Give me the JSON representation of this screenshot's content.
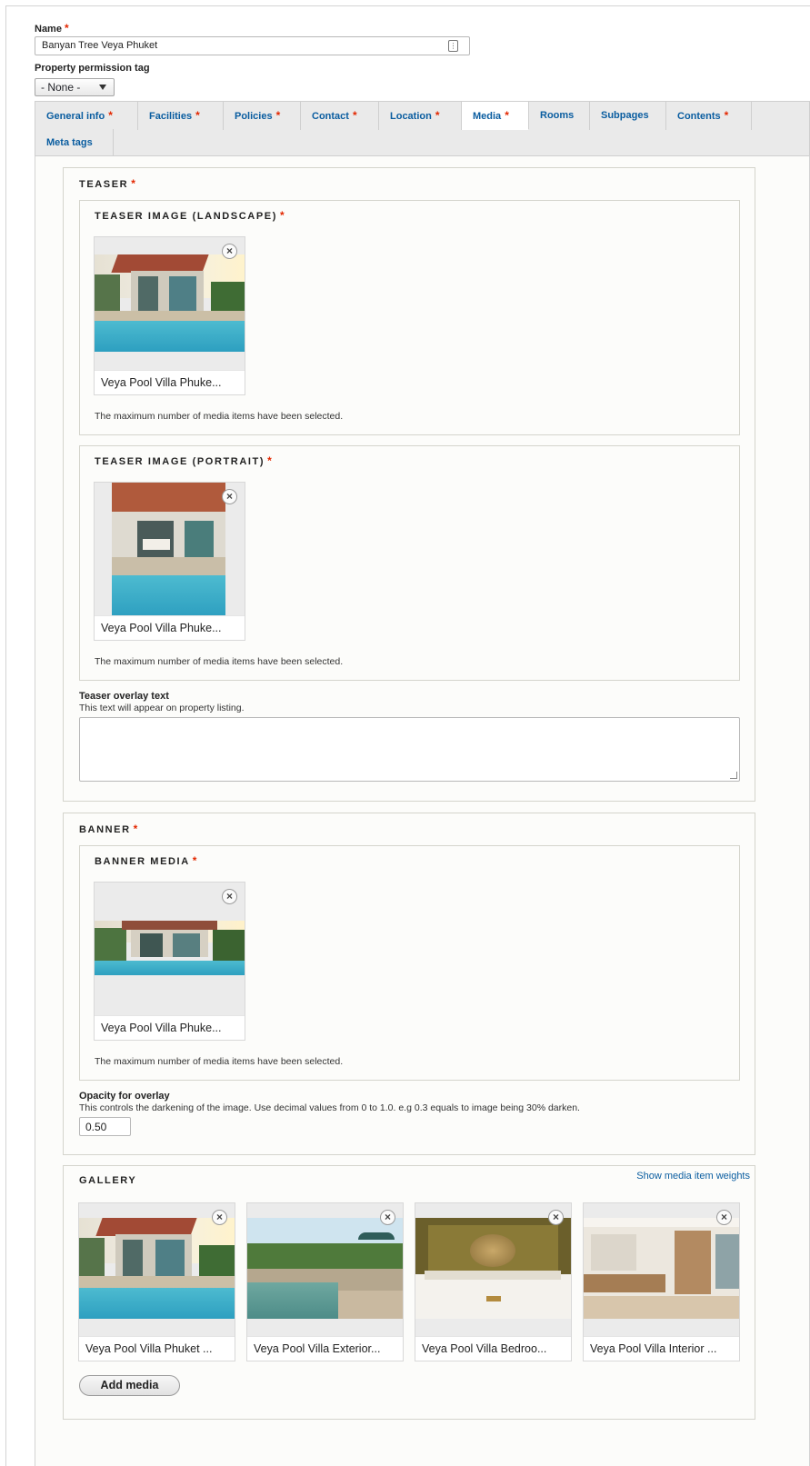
{
  "form": {
    "name_label": "Name",
    "name_value": "Banyan Tree Veya Phuket",
    "permission_label": "Property permission tag",
    "permission_value": "- None -"
  },
  "tabs": [
    {
      "label": "General info",
      "required": true
    },
    {
      "label": "Facilities",
      "required": true
    },
    {
      "label": "Policies",
      "required": true
    },
    {
      "label": "Contact",
      "required": true
    },
    {
      "label": "Location",
      "required": true
    },
    {
      "label": "Media",
      "required": true,
      "active": true
    },
    {
      "label": "Rooms",
      "required": false
    },
    {
      "label": "Subpages",
      "required": false
    },
    {
      "label": "Contents",
      "required": true
    },
    {
      "label": "Meta tags",
      "required": false
    }
  ],
  "teaser": {
    "legend": "TEASER",
    "landscape": {
      "legend": "TEASER IMAGE (LANDSCAPE)",
      "item_name": "Veya Pool Villa Phuke...",
      "max_text": "The maximum number of media items have been selected."
    },
    "portrait": {
      "legend": "TEASER IMAGE (PORTRAIT)",
      "item_name": "Veya Pool Villa Phuke...",
      "max_text": "The maximum number of media items have been selected."
    },
    "overlay_label": "Teaser overlay text",
    "overlay_desc": "This text will appear on property listing.",
    "overlay_value": ""
  },
  "banner": {
    "legend": "BANNER",
    "media_legend": "BANNER MEDIA",
    "item_name": "Veya Pool Villa Phuke...",
    "max_text": "The maximum number of media items have been selected.",
    "opacity_label": "Opacity for overlay",
    "opacity_desc": "This controls the darkening of the image. Use decimal values from 0 to 1.0. e.g 0.3 equals to image being 30% darken.",
    "opacity_value": "0.50"
  },
  "gallery": {
    "legend": "GALLERY",
    "weights_link": "Show media item weights",
    "items": [
      {
        "name": "Veya Pool Villa Phuket ..."
      },
      {
        "name": "Veya Pool Villa Exterior..."
      },
      {
        "name": "Veya Pool Villa Bedroo..."
      },
      {
        "name": "Veya Pool Villa Interior ..."
      }
    ],
    "add_button": "Add media"
  },
  "icons": {
    "remove": "close-circle-icon",
    "keychain": "password-manager-icon",
    "dropdown": "chevron-down-icon"
  },
  "colors": {
    "link": "#0a5da0",
    "required": "#e32700",
    "tab_bar": "#eaeaea"
  },
  "glyphs": {
    "required": "*",
    "remove": "×"
  }
}
